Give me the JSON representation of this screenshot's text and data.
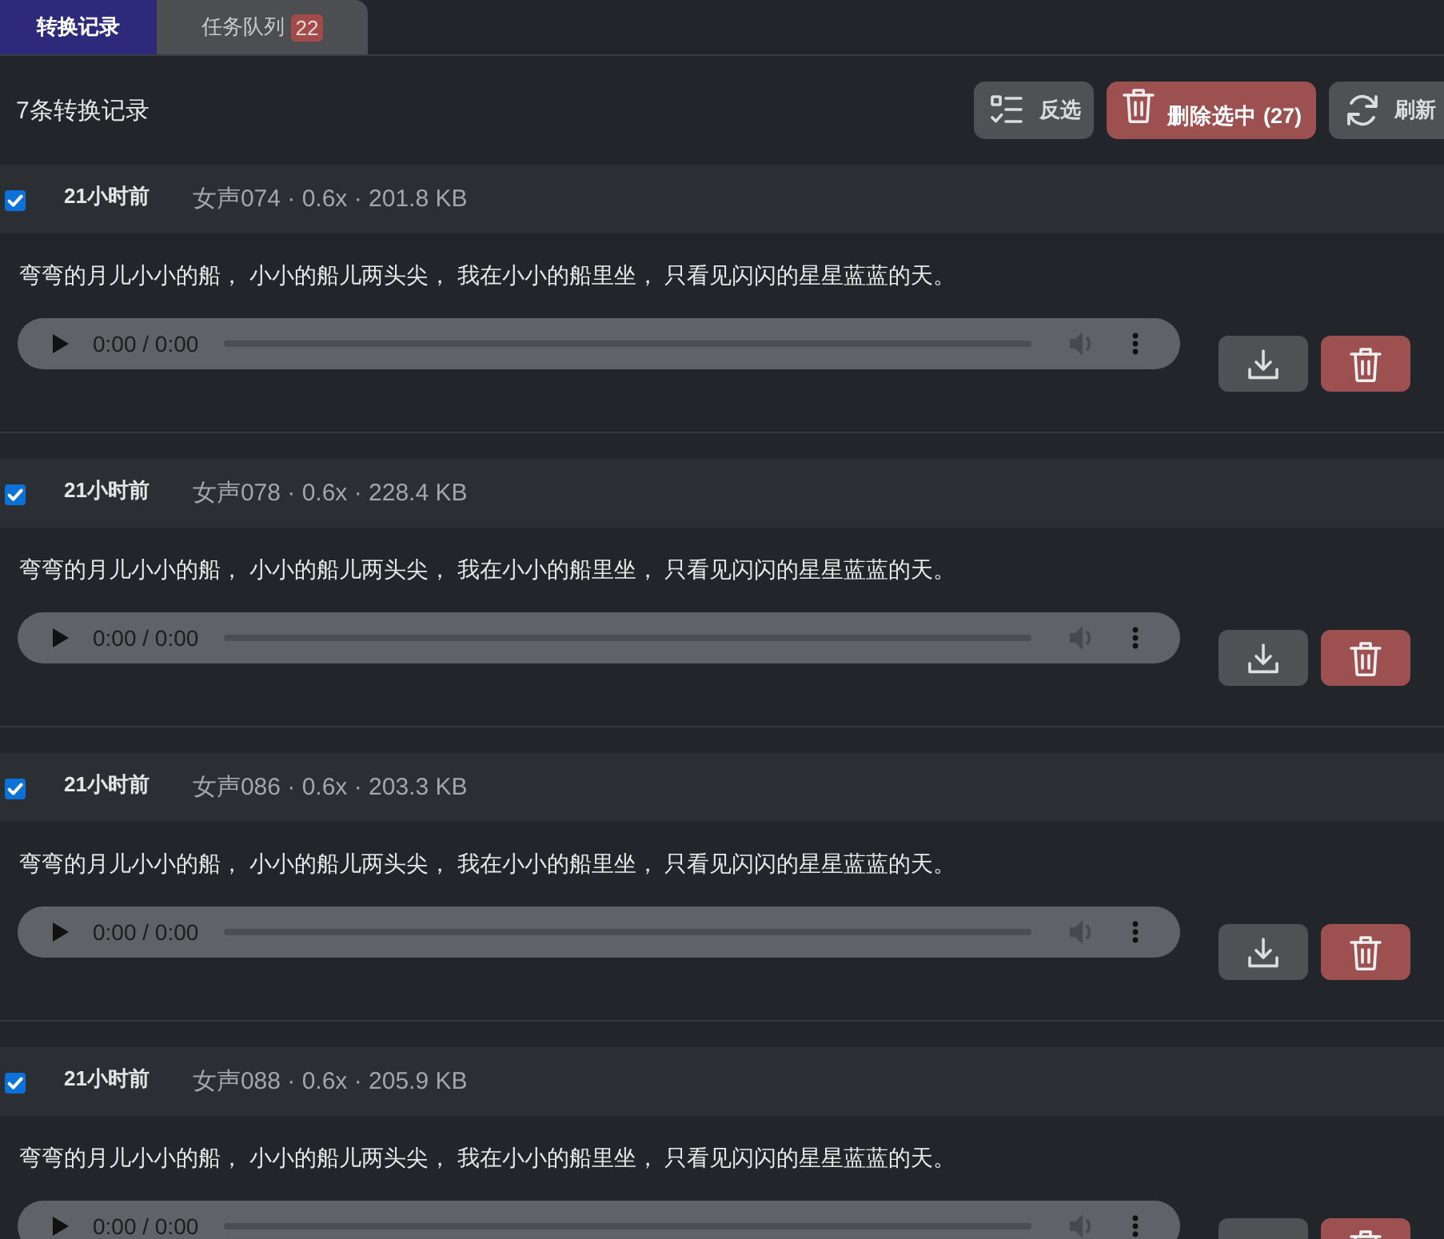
{
  "tabs": [
    {
      "label": "转换记录",
      "selected": true
    },
    {
      "label": "任务队列",
      "badge": "22",
      "selected": false
    }
  ],
  "toolbar": {
    "title": "7条转换记录",
    "buttons": [
      {
        "kind": "invert",
        "label": "反选"
      },
      {
        "kind": "delete",
        "label": "删除选中 (27)"
      },
      {
        "kind": "refresh",
        "label": "刷新"
      }
    ]
  },
  "records": [
    {
      "checked": true,
      "time": "21小时前",
      "meta": "女声074 · 0.6x · 201.8 KB",
      "text": "弯弯的月儿小小的船， 小小的船儿两头尖， 我在小小的船里坐， 只看见闪闪的星星蓝蓝的天。",
      "player": {
        "time": "0:00 / 0:00"
      }
    },
    {
      "checked": true,
      "time": "21小时前",
      "meta": "女声078 · 0.6x · 228.4 KB",
      "text": "弯弯的月儿小小的船， 小小的船儿两头尖， 我在小小的船里坐， 只看见闪闪的星星蓝蓝的天。",
      "player": {
        "time": "0:00 / 0:00"
      }
    },
    {
      "checked": true,
      "time": "21小时前",
      "meta": "女声086 · 0.6x · 203.3 KB",
      "text": "弯弯的月儿小小的船， 小小的船儿两头尖， 我在小小的船里坐， 只看见闪闪的星星蓝蓝的天。",
      "player": {
        "time": "0:00 / 0:00"
      }
    },
    {
      "checked": true,
      "time": "21小时前",
      "meta": "女声088 · 0.6x · 205.9 KB",
      "text": "弯弯的月儿小小的船， 小小的船儿两头尖， 我在小小的船里坐， 只看见闪闪的星星蓝蓝的天。",
      "player": {
        "time": "0:00 / 0:00"
      }
    }
  ]
}
